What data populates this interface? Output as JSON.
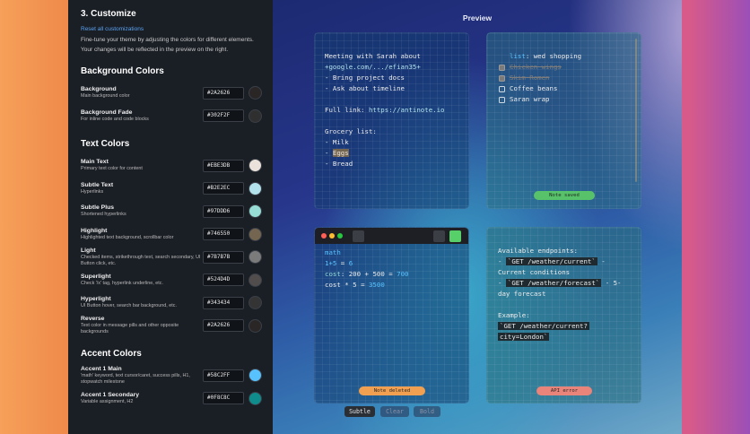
{
  "panel": {
    "title": "3. Customize",
    "reset_link": "Reset all customizations",
    "description": "Fine-tune your theme by adjusting the colors for different elements. Your changes will be reflected in the preview on the right.",
    "sections": {
      "background": {
        "title": "Background Colors",
        "rows": [
          {
            "label": "Background",
            "desc": "Main background color",
            "hex": "#2A2626",
            "color": "#2a2626"
          },
          {
            "label": "Background Fade",
            "desc": "For inline code and code blocks",
            "hex": "#302F2F",
            "color": "#302f2f"
          }
        ]
      },
      "text": {
        "title": "Text Colors",
        "rows": [
          {
            "label": "Main Text",
            "desc": "Primary text color for content",
            "hex": "#EBE3DB",
            "color": "#ebe3db"
          },
          {
            "label": "Subtle Text",
            "desc": "Hyperlinks",
            "hex": "#B2E2EC",
            "color": "#b2e2ec"
          },
          {
            "label": "Subtle Plus",
            "desc": "Shortened hyperlinks",
            "hex": "#97DDD6",
            "color": "#97ddd6"
          },
          {
            "label": "Highlight",
            "desc": "Highlighted text background, scrollbar color",
            "hex": "#746550",
            "color": "#746550"
          },
          {
            "label": "Light",
            "desc": "Checked items, strikethrough text, search secondary, UI Button click, etc.",
            "hex": "#7B7B7B",
            "color": "#7b7b7b"
          },
          {
            "label": "Superlight",
            "desc": "Check '/x' tag, hyperlink underline, etc.",
            "hex": "#524D4D",
            "color": "#524d4d"
          },
          {
            "label": "Hyperlight",
            "desc": "UI Button hover, search bar background, etc.",
            "hex": "#343434",
            "color": "#343434"
          },
          {
            "label": "Reverse",
            "desc": "Text color in message pills and other opposite backgrounds",
            "hex": "#2A2626",
            "color": "#2a2626"
          }
        ]
      },
      "accent": {
        "title": "Accent Colors",
        "rows": [
          {
            "label": "Accent 1 Main",
            "desc": "'math' keyword, text cursor/caret, success pills, H1, stopwatch milestone",
            "hex": "#58C2FF",
            "color": "#58c2ff"
          },
          {
            "label": "Accent 1 Secondary",
            "desc": "Variable assignment, H2",
            "hex": "#0F8C8C",
            "color": "#0f8c8c"
          }
        ]
      }
    }
  },
  "preview": {
    "title": "Preview",
    "card1": {
      "line1": "Meeting with Sarah about",
      "link_short": "+google.com/.../efian35+",
      "line3": "- Bring project docs",
      "line4": "- Ask about timeline",
      "full_link_label": "Full link: ",
      "full_link_url": "https://antinote.io",
      "grocery_title": "Grocery list:",
      "item_milk": "- Milk",
      "item_eggs_dash": "- ",
      "item_eggs": "Eggs",
      "item_bread": "- Bread"
    },
    "card2": {
      "list_keyword": "list",
      "list_rest": ": wed shopping",
      "items": [
        {
          "text": "Chicken wings",
          "checked": true
        },
        {
          "text": "Skim Romen",
          "checked": true
        },
        {
          "text": "Coffee beans",
          "checked": false
        },
        {
          "text": "Saran wrap",
          "checked": false
        }
      ],
      "pill": "Note saved",
      "pill_color": "#58c26a"
    },
    "card3": {
      "math_kw": "math",
      "l2a": "1+5",
      "l2b": " = ",
      "l2c": "6",
      "l3a": "cost",
      "l3b": ": ",
      "l3c": "200",
      "l3d": " + ",
      "l3e": "500",
      "l3f": " = ",
      "l3g": "700",
      "l4a": "cost",
      "l4b": " * ",
      "l4c": "5",
      "l4d": " = ",
      "l4e": "3500",
      "pill": "Note deleted",
      "pill_color": "#f0a050"
    },
    "card4": {
      "heading": "Available endpoints:",
      "l2a": "- ",
      "l2code": "`GET /weather/current`",
      "l2b": " -",
      "l3": "Current conditions",
      "l4a": "- ",
      "l4code": "`GET /weather/forecast`",
      "l4b": " - 5-",
      "l5": "day forecast",
      "l6": "Example:",
      "l7code": "`GET /weather/current?",
      "l8code": "city=London`",
      "pill": "API error",
      "pill_color": "#e8847a"
    },
    "format_buttons": [
      "Subtle",
      "Clear",
      "Bold"
    ]
  }
}
